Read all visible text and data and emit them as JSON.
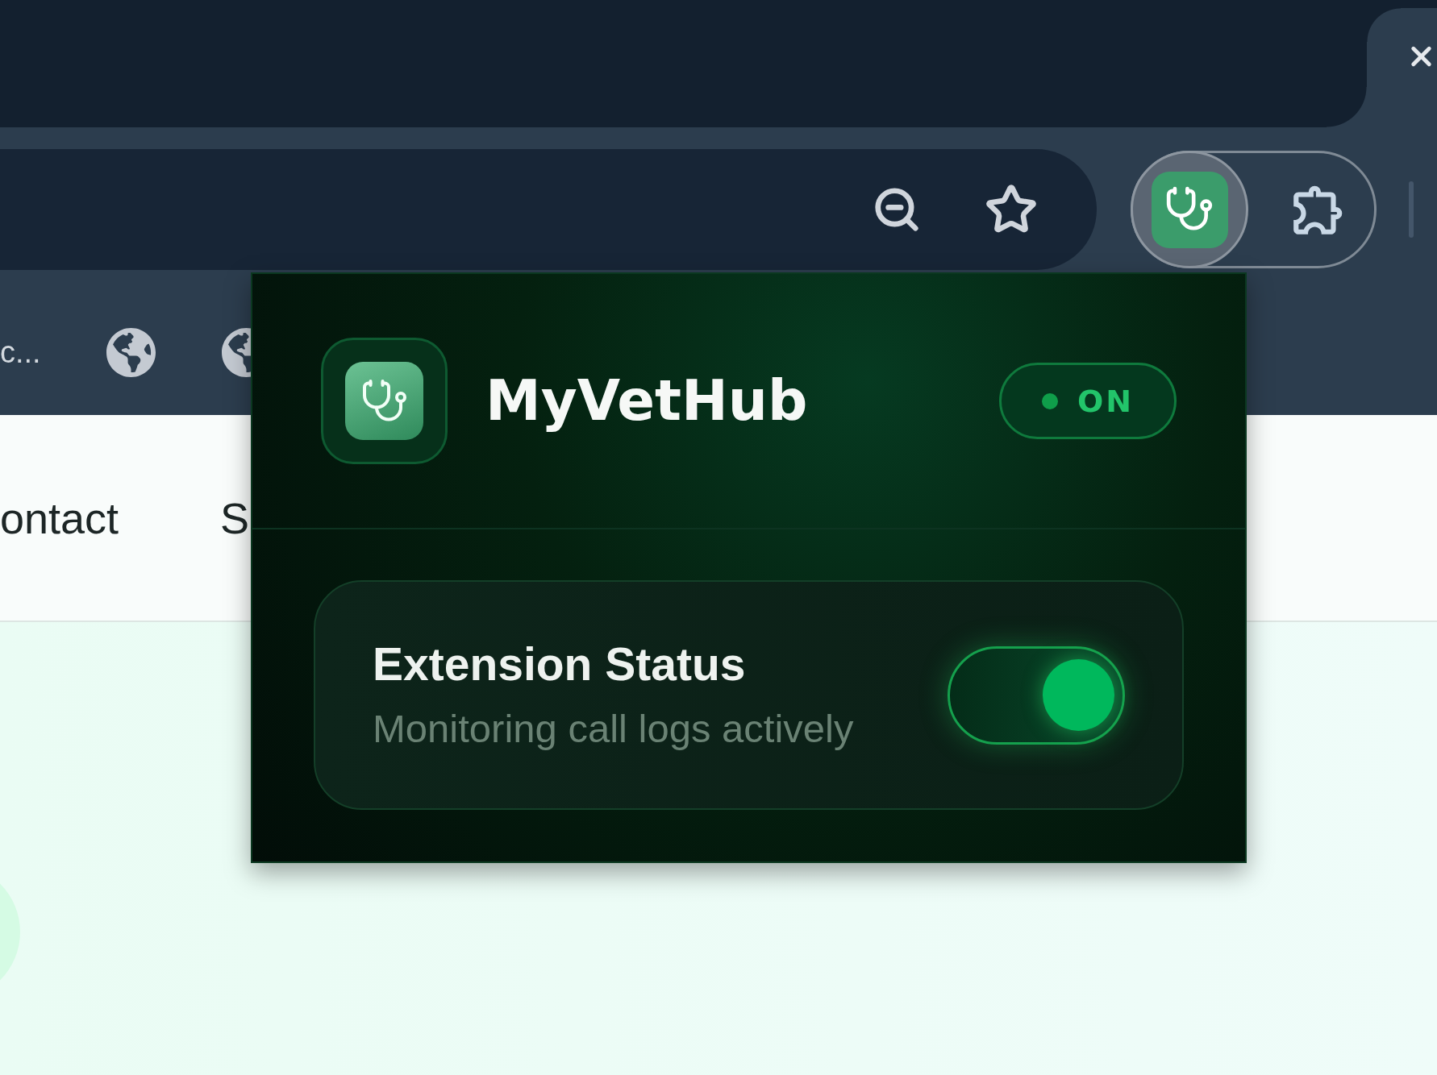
{
  "browser": {
    "toolbar": {
      "extension_button": {
        "pressed": true
      }
    },
    "bookmarks": [
      {
        "kind": "text",
        "label": "c..."
      },
      {
        "kind": "favicon"
      },
      {
        "kind": "favicon"
      }
    ]
  },
  "page": {
    "nav_links": [
      "ontact",
      "S"
    ]
  },
  "popup": {
    "title": "MyVetHub",
    "badge": {
      "label": "ON",
      "on": true
    },
    "status_card": {
      "title": "Extension Status",
      "subtitle": "Monitoring call logs actively",
      "toggle": {
        "on": true
      }
    }
  }
}
